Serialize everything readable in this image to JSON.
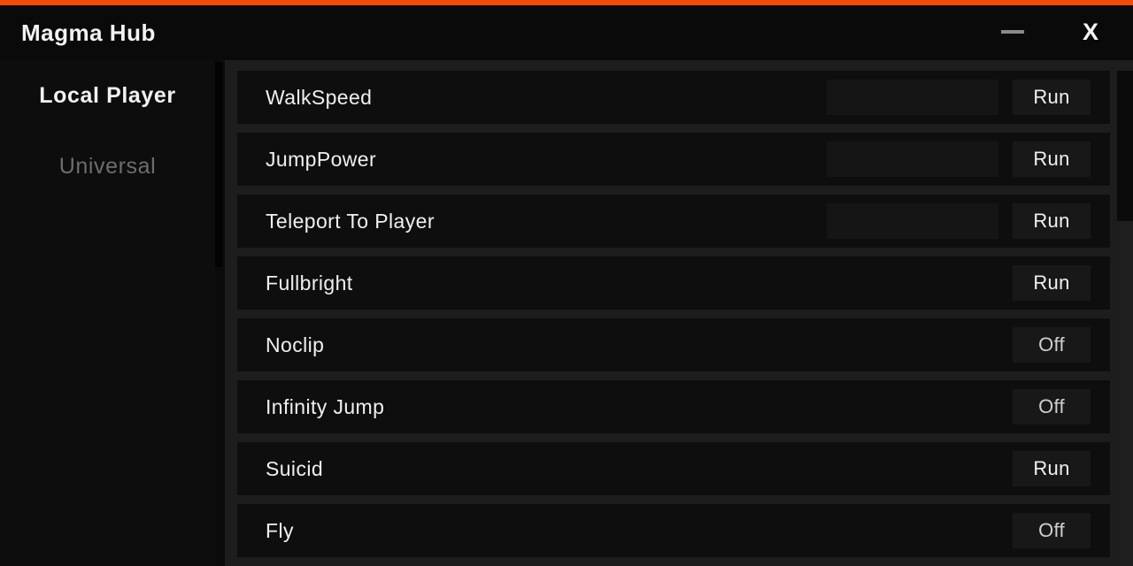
{
  "window": {
    "title": "Magma Hub",
    "accent_color": "#f64b06",
    "background_color": "#0c0c0c",
    "minimize_label": "—",
    "minimize_icon": "minimize-icon",
    "close_label": "X",
    "close_icon": "close-icon"
  },
  "sidebar": {
    "items": [
      {
        "label": "Local Player",
        "active": true
      },
      {
        "label": "Universal",
        "active": false
      }
    ]
  },
  "main": {
    "rows": [
      {
        "label": "WalkSpeed",
        "has_input": true,
        "input_value": "",
        "input_placeholder": "",
        "action": "Run",
        "action_state": "run"
      },
      {
        "label": "JumpPower",
        "has_input": true,
        "input_value": "",
        "input_placeholder": "",
        "action": "Run",
        "action_state": "run"
      },
      {
        "label": "Teleport To Player",
        "has_input": true,
        "input_value": "",
        "input_placeholder": "",
        "action": "Run",
        "action_state": "run"
      },
      {
        "label": "Fullbright",
        "has_input": false,
        "input_value": "",
        "input_placeholder": "",
        "action": "Run",
        "action_state": "run"
      },
      {
        "label": "Noclip",
        "has_input": false,
        "input_value": "",
        "input_placeholder": "",
        "action": "Off",
        "action_state": "off"
      },
      {
        "label": "Infinity Jump",
        "has_input": false,
        "input_value": "",
        "input_placeholder": "",
        "action": "Off",
        "action_state": "off"
      },
      {
        "label": "Suicid",
        "has_input": false,
        "input_value": "",
        "input_placeholder": "",
        "action": "Run",
        "action_state": "run"
      },
      {
        "label": "Fly",
        "has_input": false,
        "input_value": "",
        "input_placeholder": "",
        "action": "Off",
        "action_state": "off"
      }
    ]
  }
}
